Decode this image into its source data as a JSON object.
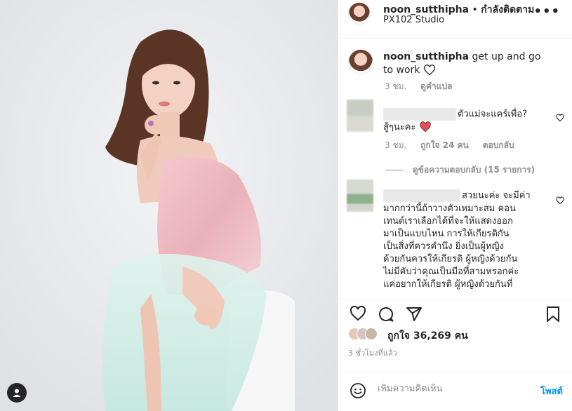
{
  "header": {
    "username": "noon_sutthipha",
    "separator": " • ",
    "follow_status": "กำลังติดตาม",
    "location": "PX102 Studio",
    "more": "•••"
  },
  "caption": {
    "username": "noon_sutthipha",
    "text": "get up and go to work",
    "time": "3 ชม.",
    "translate": "ดูคำแปล"
  },
  "comment1": {
    "text": "ตัวแม่จะแคร์เพื่อ?",
    "text2": "สู้ๆนะคะ",
    "time": "3 ชม.",
    "likes": "ถูกใจ 24 คน",
    "reply": "ตอบกลับ",
    "view_replies": "ดูข้อความตอบกลับ (15 รายการ)"
  },
  "comment2": {
    "lines": [
      "สวยนะค่ะ จะมีค่า",
      "มากกว่านี้ถ้าวางตัวเหมาะสม คอน",
      "เทนต์เราเลือกได้ที่จะให้แสดงออก",
      "มาเป็นแบบไหน การให้เกียรติกัน",
      "เป็นสิ่งที่ควรคำนึง ยิ่งเป็นผู้หญิง",
      "ด้วยกันควรให้เกียรติ ผู้หญิงด้วยกัน",
      "ไม่มีคับว่าคุณเป็นมือที่สามหรอกค่ะ",
      "แค่อยากให้เกียรติ ผู้หญิงด้วยกันที่"
    ]
  },
  "likes": {
    "label": "ถูกใจ 36,269 คน"
  },
  "time_ago": "3 ชั่วโมงที่แล้ว",
  "add_comment": {
    "placeholder": "เพิ่มความคิดเห็น",
    "post": "โพสต์"
  },
  "colors": {
    "text": "#262626",
    "secondary": "#8e8e8e",
    "link": "#0095f6",
    "heart_red": "#ed4956",
    "border": "#efefef"
  },
  "icons": [
    "heart-icon",
    "comment-icon",
    "share-icon",
    "bookmark-icon",
    "emoji-icon",
    "user-tag-icon",
    "more-icon"
  ]
}
